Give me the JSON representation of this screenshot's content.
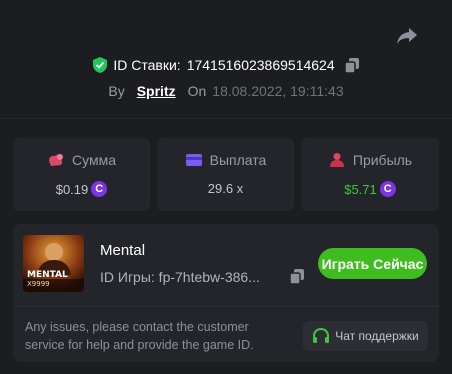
{
  "bet": {
    "id_label": "ID Ставки:",
    "id_value": "1741516023869514624",
    "by_label": "By",
    "username": "Spritz",
    "on_label": "On",
    "datetime": "18.08.2022, 19:11:43"
  },
  "stats": {
    "amount": {
      "label": "Сумма",
      "value": "$0.19"
    },
    "payout": {
      "label": "Выплата",
      "value": "29.6 x"
    },
    "profit": {
      "label": "Прибыль",
      "value": "$5.71"
    },
    "coin_symbol": "C"
  },
  "game": {
    "thumbnail_title": "MENTAL",
    "thumbnail_subtitle": "X9999",
    "name": "Mental",
    "id_text": "ID Игры: fp-7htebw-386...",
    "play_label": "Играть Сейчас"
  },
  "support": {
    "issues_text": "Any issues, please contact the customer service for help and provide the game ID.",
    "button_label": "Чат поддержки"
  },
  "colors": {
    "background": "#1c1d21",
    "card": "#24252a",
    "accent_green": "#3fbd1f",
    "profit_green": "#3ec73e",
    "coin_purple": "#7b34e8",
    "shield_green": "#22c55e"
  }
}
